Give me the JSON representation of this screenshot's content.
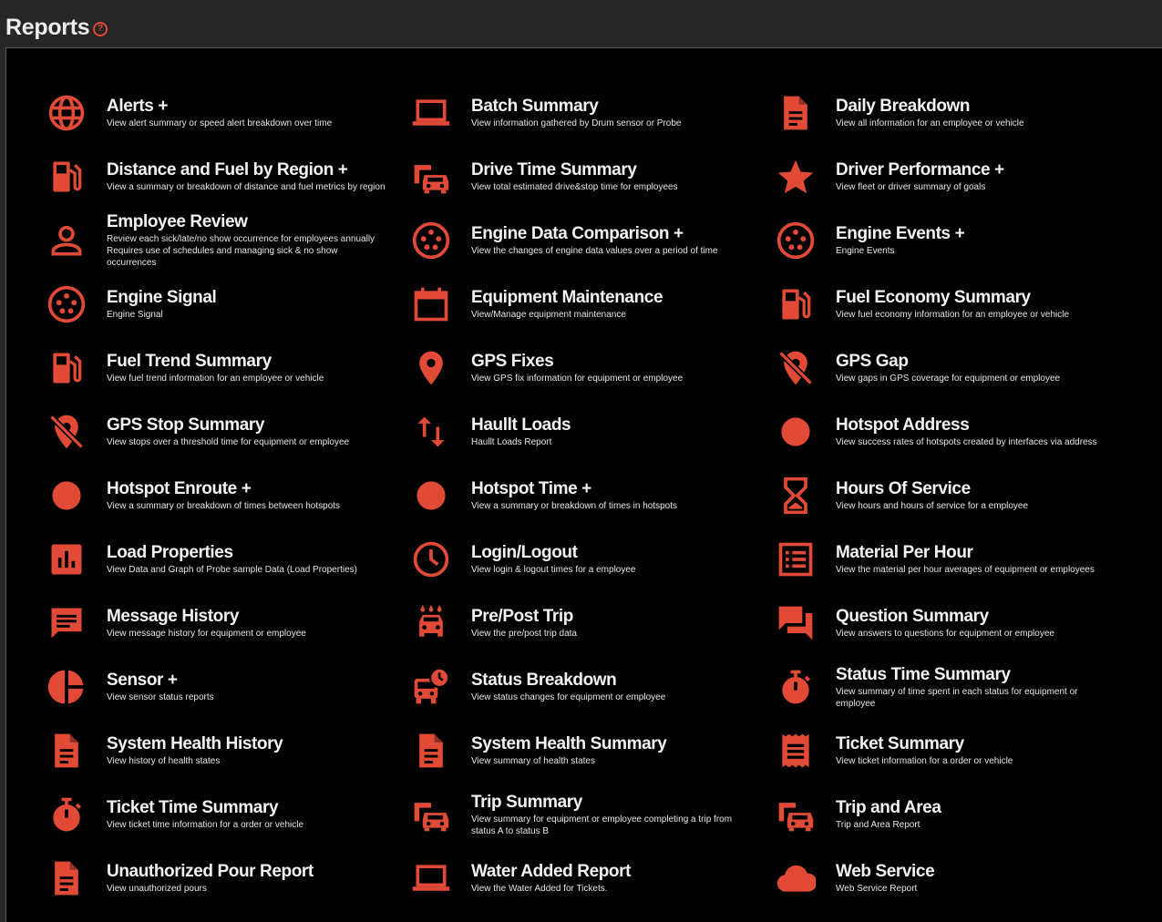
{
  "page": {
    "title": "Reports",
    "help_glyph": "?"
  },
  "accent_color": "#e04a37",
  "reports": [
    {
      "icon": "globe-icon",
      "name": "Alerts +",
      "desc": "View alert summary or speed alert breakdown over time"
    },
    {
      "icon": "laptop-icon",
      "name": "Batch Summary",
      "desc": "View information gathered by Drum sensor or Probe"
    },
    {
      "icon": "document-icon",
      "name": "Daily Breakdown",
      "desc": "View all information for an employee or vehicle"
    },
    {
      "icon": "fuel-pump-icon",
      "name": "Distance and Fuel by Region +",
      "desc": "View a summary or breakdown of distance and fuel metrics by region"
    },
    {
      "icon": "vehicles-icon",
      "name": "Drive Time Summary",
      "desc": "View total estimated drive&stop time for employees"
    },
    {
      "icon": "star-icon",
      "name": "Driver Performance +",
      "desc": "View fleet or driver summary of goals"
    },
    {
      "icon": "person-icon",
      "name": "Employee Review",
      "desc": "Review each sick/late/no show occurrence for employees annually\nRequires use of schedules and managing sick & no show occurrences"
    },
    {
      "icon": "engine-port-icon",
      "name": "Engine Data Comparison +",
      "desc": "View the changes of engine data values over a period of time"
    },
    {
      "icon": "engine-port-icon",
      "name": "Engine Events +",
      "desc": "Engine Events"
    },
    {
      "icon": "engine-port-icon",
      "name": "Engine Signal",
      "desc": "Engine Signal"
    },
    {
      "icon": "calendar-icon",
      "name": "Equipment Maintenance",
      "desc": "View/Manage equipment maintenance"
    },
    {
      "icon": "fuel-pump-icon",
      "name": "Fuel Economy Summary",
      "desc": "View fuel economy information for an employee or vehicle"
    },
    {
      "icon": "fuel-pump-icon",
      "name": "Fuel Trend Summary",
      "desc": "View fuel trend information for an employee or vehicle"
    },
    {
      "icon": "location-pin-icon",
      "name": "GPS Fixes",
      "desc": "View GPS fix information for equipment or employee"
    },
    {
      "icon": "location-off-icon",
      "name": "GPS Gap",
      "desc": "View gaps in GPS coverage for equipment or employee"
    },
    {
      "icon": "location-off-icon",
      "name": "GPS Stop Summary",
      "desc": "View stops over a threshold time for equipment or employee"
    },
    {
      "icon": "swap-vertical-icon",
      "name": "Haullt Loads",
      "desc": "Haullt Loads Report"
    },
    {
      "icon": "circle-icon",
      "name": "Hotspot Address",
      "desc": "View success rates of hotspots created by interfaces via address"
    },
    {
      "icon": "circle-icon",
      "name": "Hotspot Enroute +",
      "desc": "View a summary or breakdown of times between hotspots"
    },
    {
      "icon": "circle-icon",
      "name": "Hotspot Time +",
      "desc": "View a summary or breakdown of times in hotspots"
    },
    {
      "icon": "hourglass-icon",
      "name": "Hours Of Service",
      "desc": "View hours and hours of service for a employee"
    },
    {
      "icon": "bar-chart-icon",
      "name": "Load Properties",
      "desc": "View Data and Graph of Probe sample Data (Load Properties)"
    },
    {
      "icon": "clock-icon",
      "name": "Login/Logout",
      "desc": "View login & logout times for a employee"
    },
    {
      "icon": "list-icon",
      "name": "Material Per Hour",
      "desc": "View the material per hour averages of equipment or employees"
    },
    {
      "icon": "message-icon",
      "name": "Message History",
      "desc": "View message history for equipment or employee"
    },
    {
      "icon": "car-wash-icon",
      "name": "Pre/Post Trip",
      "desc": "View the pre/post trip data"
    },
    {
      "icon": "forum-icon",
      "name": "Question Summary",
      "desc": "View answers to questions for equipment or employee"
    },
    {
      "icon": "pie-chart-icon",
      "name": "Sensor +",
      "desc": "View sensor status reports"
    },
    {
      "icon": "bus-clock-icon",
      "name": "Status Breakdown",
      "desc": "View status changes for equipment or employee"
    },
    {
      "icon": "timer-icon",
      "name": "Status Time Summary",
      "desc": "View summary of time spent in each status for equipment or employee"
    },
    {
      "icon": "document-icon",
      "name": "System Health History",
      "desc": "View history of health states"
    },
    {
      "icon": "document-icon",
      "name": "System Health Summary",
      "desc": "View summary of health states"
    },
    {
      "icon": "receipt-icon",
      "name": "Ticket Summary",
      "desc": "View ticket information for a order or vehicle"
    },
    {
      "icon": "timer-icon",
      "name": "Ticket Time Summary",
      "desc": "View ticket time information for a order or vehicle"
    },
    {
      "icon": "vehicles-icon",
      "name": "Trip Summary",
      "desc": "View summary for equipment or employee completing a trip from status A to status B"
    },
    {
      "icon": "vehicles-icon",
      "name": "Trip and Area",
      "desc": "Trip and Area Report"
    },
    {
      "icon": "document-icon",
      "name": "Unauthorized Pour Report",
      "desc": "View unauthorized pours"
    },
    {
      "icon": "laptop-icon",
      "name": "Water Added Report",
      "desc": "View the Water Added for Tickets."
    },
    {
      "icon": "cloud-icon",
      "name": "Web Service",
      "desc": "Web Service Report"
    }
  ]
}
